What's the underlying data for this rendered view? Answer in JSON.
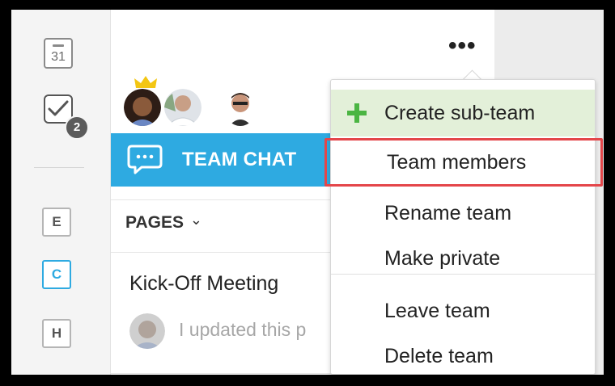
{
  "rail": {
    "calendar_day": "31",
    "task_badge": "2",
    "letters": [
      "E",
      "C",
      "H"
    ],
    "active_letter": "C"
  },
  "header": {
    "more_label": "•••"
  },
  "team_chat": {
    "label": "TEAM CHAT"
  },
  "pages": {
    "label": "PAGES",
    "chevron": "⌄"
  },
  "page_item": {
    "title": "Kick-Off Meeting",
    "snippet": "I updated this p"
  },
  "menu": {
    "items": [
      {
        "label": "Create sub-team"
      },
      {
        "label": "Team members"
      },
      {
        "label": "Rename team"
      },
      {
        "label": "Make private"
      },
      {
        "label": "Leave team"
      },
      {
        "label": "Delete team"
      }
    ]
  },
  "colors": {
    "accent_blue": "#2eaae1",
    "create_bg": "#e3f0d9",
    "plus_green": "#4bb543",
    "highlight_red": "#e4464a"
  },
  "icons": {
    "calendar": "calendar-icon",
    "tasks": "tasks-checkbox-icon",
    "chat": "chat-bubble-icon",
    "plus": "plus-icon",
    "more": "more-dots-icon",
    "crown": "crown-icon"
  }
}
